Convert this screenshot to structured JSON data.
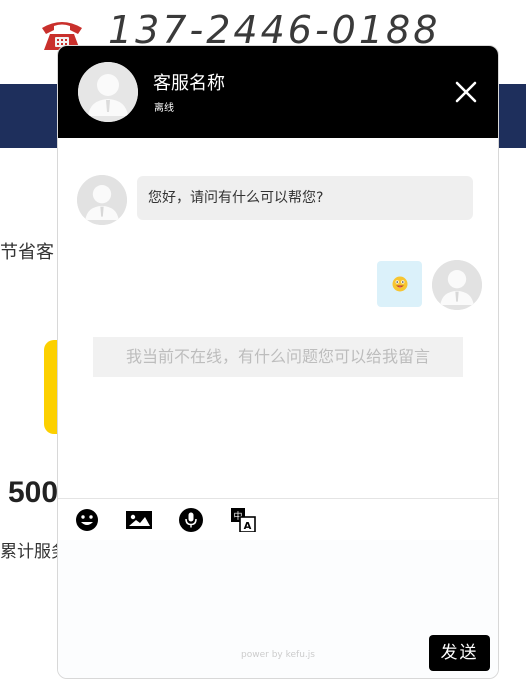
{
  "background": {
    "phone_number": "137-2446-0188",
    "text_left_1": "节省客",
    "stat_number": "500",
    "text_left_2": "累计服务"
  },
  "chat": {
    "agent_name": "客服名称",
    "agent_status": "离线",
    "greeting": "您好，请问有什么可以帮您?",
    "sent_emoji": "😜",
    "offline_notice": "我当前不在线，有什么问题您可以给我留言",
    "toolbar_icons": [
      "emoji-icon",
      "image-icon",
      "microphone-icon",
      "translate-icon"
    ],
    "powered_by": "power by kefu.js",
    "send_label": "发送"
  },
  "colors": {
    "header_bg": "#000000",
    "navbar_bg": "#1e2f5c",
    "left_bubble_bg": "#efefef",
    "right_bubble_bg": "#dbf1fa",
    "accent_yellow": "#fcd000"
  }
}
